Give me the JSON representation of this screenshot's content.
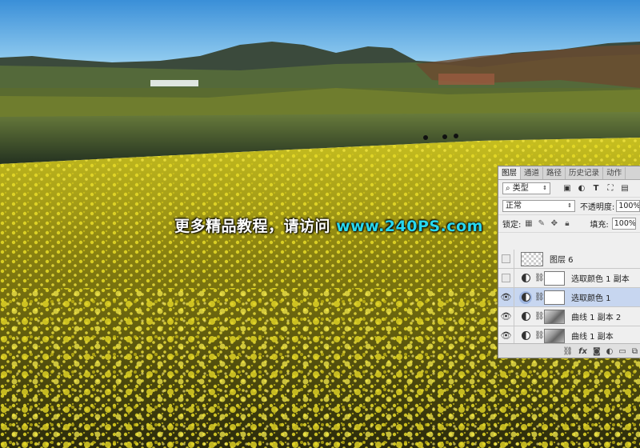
{
  "watermark": {
    "text": "更多精品教程，请访问 ",
    "url": "www.240PS.com"
  },
  "panel": {
    "tabs": [
      "图层",
      "通道",
      "路径",
      "历史记录",
      "动作"
    ],
    "filter_kind": "类型",
    "filter_icons": [
      "image-filter-icon",
      "adjustment-filter-icon",
      "type-filter-icon",
      "shape-filter-icon",
      "smart-object-filter-icon"
    ],
    "blend_mode": "正常",
    "opacity_label": "不透明度:",
    "opacity_value": "100%",
    "lock_label": "锁定:",
    "fill_label": "填充:",
    "fill_value": "100%",
    "layers": [
      {
        "name": "图层 6",
        "visible": false,
        "thumb": "checker",
        "adjustment": false,
        "selected": false
      },
      {
        "name": "选取颜色 1 副本",
        "visible": false,
        "thumb": "white",
        "adjustment": true,
        "selected": false
      },
      {
        "name": "选取颜色 1",
        "visible": true,
        "thumb": "white",
        "adjustment": true,
        "selected": true
      },
      {
        "name": "曲线 1 副本 2",
        "visible": true,
        "thumb": "curve",
        "adjustment": true,
        "selected": false
      },
      {
        "name": "曲线 1 副本",
        "visible": true,
        "thumb": "curve",
        "adjustment": true,
        "selected": false
      }
    ],
    "bottom_icons": [
      "link-icon",
      "fx-icon",
      "mask-icon",
      "new-adjustment-icon",
      "group-icon",
      "new-layer-icon"
    ]
  },
  "colors": {
    "rapeseed": "#d8c818",
    "sky": "#6fb4e6",
    "selected_row": "#c7d6f0",
    "watermark_url": "#28d8f0"
  }
}
